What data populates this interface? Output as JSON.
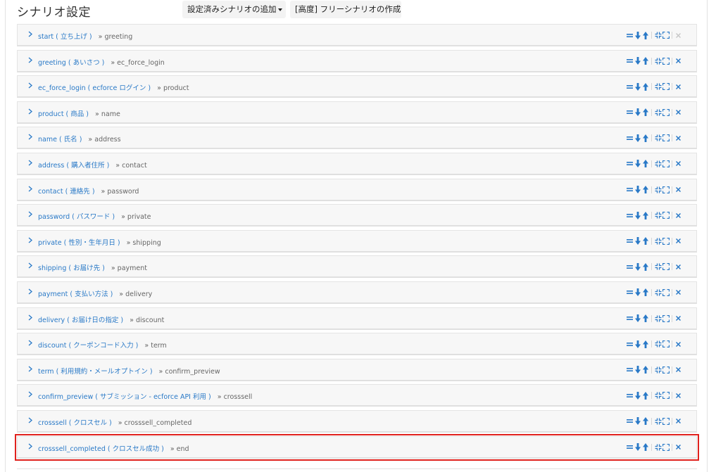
{
  "header": {
    "title": "シナリオ設定",
    "add_button_label": "設定済みシナリオの追加",
    "free_button_label": "[高度] フリーシナリオの作成"
  },
  "colors": {
    "link": "#2979c7",
    "selected_border": "#e0211d"
  },
  "scenarios": [
    {
      "label": "start ( 立ち上げ )",
      "next": "» greeting",
      "delete_enabled": false,
      "selected": false
    },
    {
      "label": "greeting ( あいさつ )",
      "next": "» ec_force_login",
      "delete_enabled": true,
      "selected": false
    },
    {
      "label": "ec_force_login ( ecforce ログイン )",
      "next": "» product",
      "delete_enabled": true,
      "selected": false
    },
    {
      "label": "product ( 商品 )",
      "next": "» name",
      "delete_enabled": true,
      "selected": false
    },
    {
      "label": "name ( 氏名 )",
      "next": "» address",
      "delete_enabled": true,
      "selected": false
    },
    {
      "label": "address ( 購入者住所 )",
      "next": "» contact",
      "delete_enabled": true,
      "selected": false
    },
    {
      "label": "contact ( 連絡先 )",
      "next": "» password",
      "delete_enabled": true,
      "selected": false
    },
    {
      "label": "password ( パスワード )",
      "next": "» private",
      "delete_enabled": true,
      "selected": false
    },
    {
      "label": "private ( 性別・生年月日 )",
      "next": "» shipping",
      "delete_enabled": true,
      "selected": false
    },
    {
      "label": "shipping ( お届け先 )",
      "next": "» payment",
      "delete_enabled": true,
      "selected": false
    },
    {
      "label": "payment ( 支払い方法 )",
      "next": "» delivery",
      "delete_enabled": true,
      "selected": false
    },
    {
      "label": "delivery ( お届け日の指定 )",
      "next": "» discount",
      "delete_enabled": true,
      "selected": false
    },
    {
      "label": "discount ( クーポンコード入力 )",
      "next": "» term",
      "delete_enabled": true,
      "selected": false
    },
    {
      "label": "term ( 利用規約・メールオプトイン )",
      "next": "» confirm_preview",
      "delete_enabled": true,
      "selected": false
    },
    {
      "label": "confirm_preview ( サブミッション - ecforce API 利用 )",
      "next": "» crosssell",
      "delete_enabled": true,
      "selected": false
    },
    {
      "label": "crosssell ( クロスセル )",
      "next": "» crosssell_completed",
      "delete_enabled": true,
      "selected": false
    },
    {
      "label": "crosssell_completed ( クロスセル成功 )",
      "next": "» end",
      "delete_enabled": true,
      "selected": true
    }
  ],
  "row_icons": {
    "chevron": "chevron-right-icon",
    "drag": "drag-handle-icon",
    "move_down": "arrow-down-icon",
    "move_up": "arrow-up-icon",
    "collapse": "collapse-icon",
    "expand": "expand-icon",
    "delete": "close-icon"
  }
}
